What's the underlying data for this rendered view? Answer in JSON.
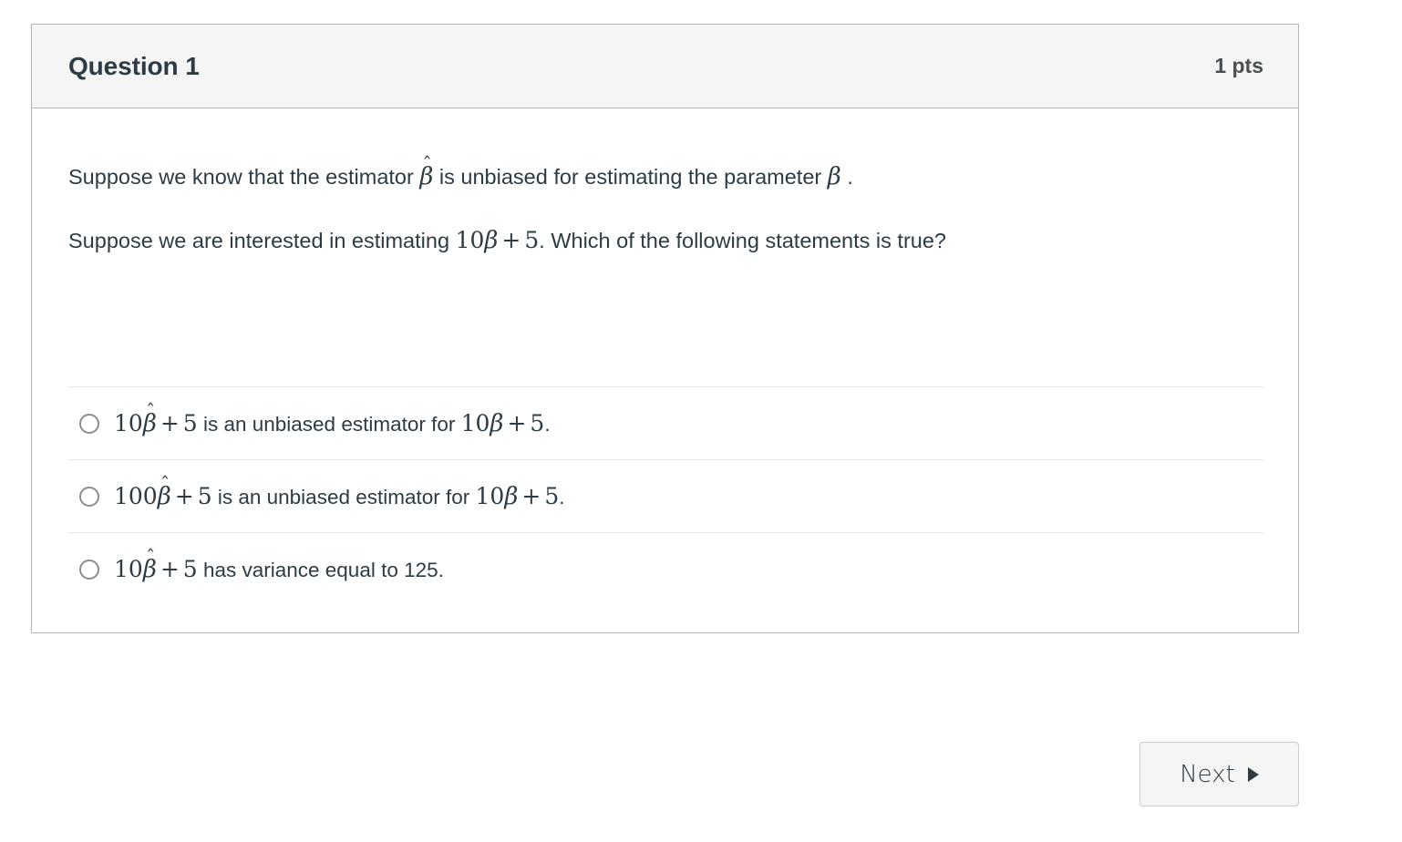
{
  "question": {
    "title": "Question 1",
    "points": "1 pts",
    "prompt_lines": [
      {
        "segments": [
          {
            "type": "text",
            "value": "Suppose we know that the estimator "
          },
          {
            "type": "math_hat_var",
            "value": "β"
          },
          {
            "type": "text",
            "value": " is unbiased for estimating the parameter "
          },
          {
            "type": "math_var",
            "value": "β"
          },
          {
            "type": "text",
            "value": " ."
          }
        ],
        "plain": "Suppose we know that the estimator β̂ is unbiased for estimating the parameter β ."
      },
      {
        "segments": [
          {
            "type": "text",
            "value": "Suppose we are interested in estimating "
          },
          {
            "type": "math_num",
            "value": "10"
          },
          {
            "type": "math_var",
            "value": "β"
          },
          {
            "type": "math_op",
            "value": "+"
          },
          {
            "type": "math_num",
            "value": "5"
          },
          {
            "type": "text",
            "value": ". Which of the following statements is true?"
          }
        ],
        "plain": "Suppose we are interested in estimating 10β + 5. Which of the following statements is true?"
      }
    ],
    "answers": [
      {
        "id": "answer-1",
        "selected": false,
        "plain": "10β̂ + 5 is an unbiased estimator for 10β + 5.",
        "coefficient_estimator": "10",
        "constant": "5",
        "middle_text": " is an unbiased estimator for ",
        "coefficient_parameter": "10",
        "trailing": "."
      },
      {
        "id": "answer-2",
        "selected": false,
        "plain": "100β̂ + 5 is an unbiased estimator for 10β + 5.",
        "coefficient_estimator": "100",
        "constant": "5",
        "middle_text": " is an unbiased estimator for ",
        "coefficient_parameter": "10",
        "trailing": "."
      },
      {
        "id": "answer-3",
        "selected": false,
        "plain": "10β̂ + 5 has variance equal to 125.",
        "coefficient_estimator": "10",
        "constant": "5",
        "middle_text": " has variance equal to 125.",
        "coefficient_parameter": "",
        "trailing": ""
      }
    ]
  },
  "footer": {
    "next_label": "Next",
    "next_icon": "triangle-right-icon"
  },
  "symbols": {
    "beta": "β",
    "hat": "ˆ",
    "plus": "+"
  },
  "colors": {
    "page_background": "#ffffff",
    "card_border": "#b4b7ba",
    "header_background": "#f5f5f5",
    "text": "#2d3b45",
    "divider": "#e8e8e8",
    "radio_border": "#8b8e90",
    "button_background": "#f5f5f5",
    "button_border": "#c7cdd1"
  }
}
